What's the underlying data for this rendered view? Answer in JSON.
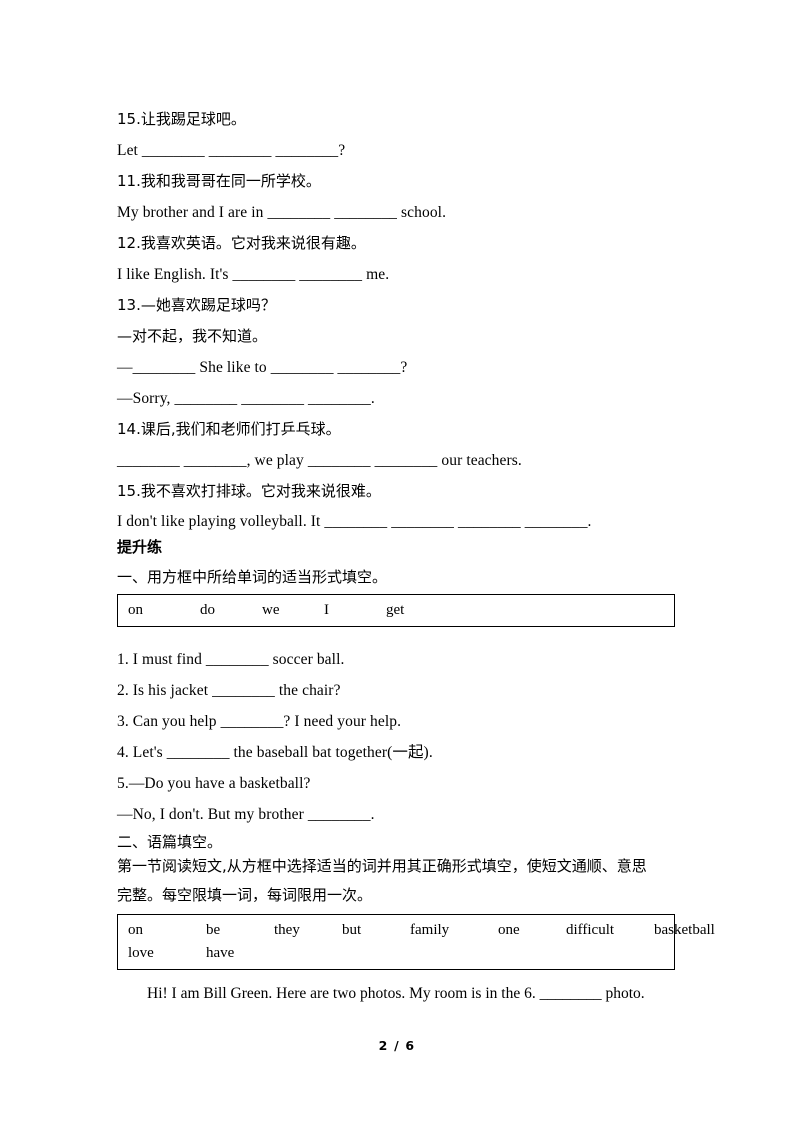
{
  "document": {
    "page_label": "2 / 6",
    "page_number": 2,
    "total_pages": 6
  },
  "translation_exercises": [
    {
      "chinese": "15.让我踢足球吧。",
      "english": "Let ________ ________ ________?"
    },
    {
      "chinese": "11.我和我哥哥在同一所学校。",
      "english": "My brother and I are in ________ ________ school."
    },
    {
      "chinese": "12.我喜欢英语。它对我来说很有趣。",
      "english": "I like English. It's ________ ________ me."
    },
    {
      "chinese": "13.—她喜欢踢足球吗？",
      "chinese2": "—对不起，我不知道。",
      "english": "—________ She like to ________ ________?",
      "english2": "—Sorry, ________ ________ ________."
    },
    {
      "chinese": "14.课后,我们和老师们打乒乓球。",
      "english": "________ ________, we play ________ ________ our teachers."
    },
    {
      "chinese": "15.我不喜欢打排球。它对我来说很难。",
      "english": "I don't like playing volleyball. It ________ ________ ________ ________."
    }
  ],
  "improve_section": {
    "title": "提升练",
    "part_one": {
      "heading": "一、用方框中所给单词的适当形式填空。",
      "word_bank": [
        "on",
        "do",
        "we",
        "I",
        "get"
      ],
      "questions": [
        "1. I must find ________ soccer ball.",
        "2. Is his jacket ________ the chair?",
        "3. Can you help ________? I need your help.",
        "4. Let's ________ the baseball bat together(一起).",
        "5.—Do you have a basketball?",
        "—No, I don't. But my brother ________."
      ]
    },
    "part_two": {
      "heading": "二、语篇填空。",
      "instructions_line1": "第一节阅读短文,从方框中选择适当的词并用其正确形式填空，使短文通顺、意思",
      "instructions_line2": "完整。每空限填一词，每词限用一次。",
      "word_bank_row1": [
        "on",
        "be",
        "they",
        "but",
        "family",
        "one",
        "difficult",
        "basketball"
      ],
      "word_bank_row2": [
        "love",
        "have"
      ],
      "passage": "Hi! I am Bill Green. Here are two photos. My room is in the 6. ________ photo."
    }
  }
}
